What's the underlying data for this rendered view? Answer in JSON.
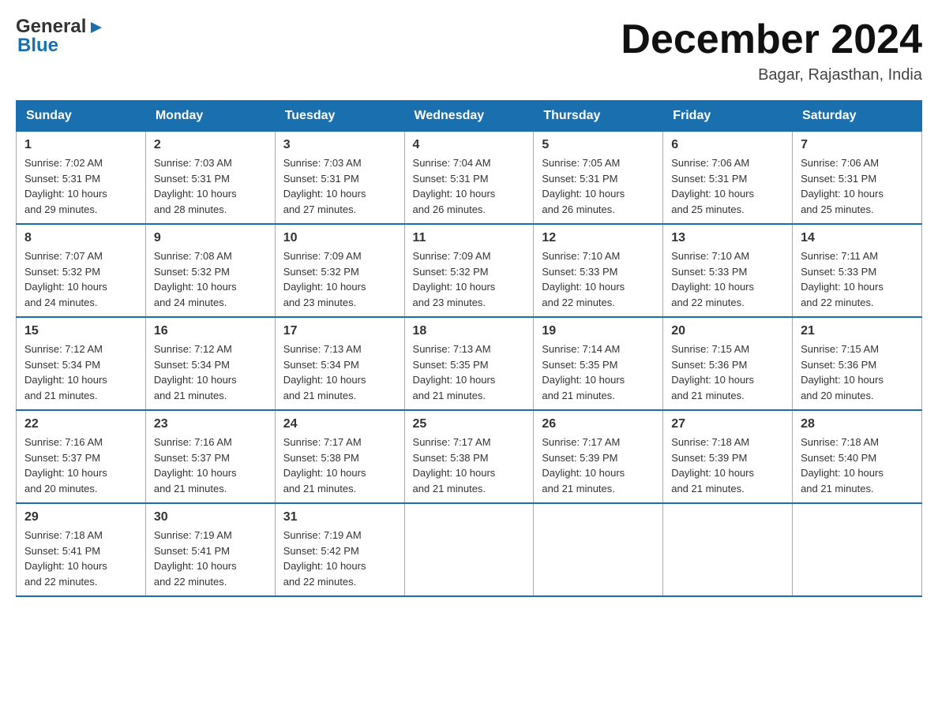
{
  "header": {
    "logo_general": "General",
    "logo_blue": "Blue",
    "month_title": "December 2024",
    "location": "Bagar, Rajasthan, India"
  },
  "days_of_week": [
    "Sunday",
    "Monday",
    "Tuesday",
    "Wednesday",
    "Thursday",
    "Friday",
    "Saturday"
  ],
  "weeks": [
    [
      {
        "day": "1",
        "sunrise": "7:02 AM",
        "sunset": "5:31 PM",
        "daylight": "10 hours and 29 minutes."
      },
      {
        "day": "2",
        "sunrise": "7:03 AM",
        "sunset": "5:31 PM",
        "daylight": "10 hours and 28 minutes."
      },
      {
        "day": "3",
        "sunrise": "7:03 AM",
        "sunset": "5:31 PM",
        "daylight": "10 hours and 27 minutes."
      },
      {
        "day": "4",
        "sunrise": "7:04 AM",
        "sunset": "5:31 PM",
        "daylight": "10 hours and 26 minutes."
      },
      {
        "day": "5",
        "sunrise": "7:05 AM",
        "sunset": "5:31 PM",
        "daylight": "10 hours and 26 minutes."
      },
      {
        "day": "6",
        "sunrise": "7:06 AM",
        "sunset": "5:31 PM",
        "daylight": "10 hours and 25 minutes."
      },
      {
        "day": "7",
        "sunrise": "7:06 AM",
        "sunset": "5:31 PM",
        "daylight": "10 hours and 25 minutes."
      }
    ],
    [
      {
        "day": "8",
        "sunrise": "7:07 AM",
        "sunset": "5:32 PM",
        "daylight": "10 hours and 24 minutes."
      },
      {
        "day": "9",
        "sunrise": "7:08 AM",
        "sunset": "5:32 PM",
        "daylight": "10 hours and 24 minutes."
      },
      {
        "day": "10",
        "sunrise": "7:09 AM",
        "sunset": "5:32 PM",
        "daylight": "10 hours and 23 minutes."
      },
      {
        "day": "11",
        "sunrise": "7:09 AM",
        "sunset": "5:32 PM",
        "daylight": "10 hours and 23 minutes."
      },
      {
        "day": "12",
        "sunrise": "7:10 AM",
        "sunset": "5:33 PM",
        "daylight": "10 hours and 22 minutes."
      },
      {
        "day": "13",
        "sunrise": "7:10 AM",
        "sunset": "5:33 PM",
        "daylight": "10 hours and 22 minutes."
      },
      {
        "day": "14",
        "sunrise": "7:11 AM",
        "sunset": "5:33 PM",
        "daylight": "10 hours and 22 minutes."
      }
    ],
    [
      {
        "day": "15",
        "sunrise": "7:12 AM",
        "sunset": "5:34 PM",
        "daylight": "10 hours and 21 minutes."
      },
      {
        "day": "16",
        "sunrise": "7:12 AM",
        "sunset": "5:34 PM",
        "daylight": "10 hours and 21 minutes."
      },
      {
        "day": "17",
        "sunrise": "7:13 AM",
        "sunset": "5:34 PM",
        "daylight": "10 hours and 21 minutes."
      },
      {
        "day": "18",
        "sunrise": "7:13 AM",
        "sunset": "5:35 PM",
        "daylight": "10 hours and 21 minutes."
      },
      {
        "day": "19",
        "sunrise": "7:14 AM",
        "sunset": "5:35 PM",
        "daylight": "10 hours and 21 minutes."
      },
      {
        "day": "20",
        "sunrise": "7:15 AM",
        "sunset": "5:36 PM",
        "daylight": "10 hours and 21 minutes."
      },
      {
        "day": "21",
        "sunrise": "7:15 AM",
        "sunset": "5:36 PM",
        "daylight": "10 hours and 20 minutes."
      }
    ],
    [
      {
        "day": "22",
        "sunrise": "7:16 AM",
        "sunset": "5:37 PM",
        "daylight": "10 hours and 20 minutes."
      },
      {
        "day": "23",
        "sunrise": "7:16 AM",
        "sunset": "5:37 PM",
        "daylight": "10 hours and 21 minutes."
      },
      {
        "day": "24",
        "sunrise": "7:17 AM",
        "sunset": "5:38 PM",
        "daylight": "10 hours and 21 minutes."
      },
      {
        "day": "25",
        "sunrise": "7:17 AM",
        "sunset": "5:38 PM",
        "daylight": "10 hours and 21 minutes."
      },
      {
        "day": "26",
        "sunrise": "7:17 AM",
        "sunset": "5:39 PM",
        "daylight": "10 hours and 21 minutes."
      },
      {
        "day": "27",
        "sunrise": "7:18 AM",
        "sunset": "5:39 PM",
        "daylight": "10 hours and 21 minutes."
      },
      {
        "day": "28",
        "sunrise": "7:18 AM",
        "sunset": "5:40 PM",
        "daylight": "10 hours and 21 minutes."
      }
    ],
    [
      {
        "day": "29",
        "sunrise": "7:18 AM",
        "sunset": "5:41 PM",
        "daylight": "10 hours and 22 minutes."
      },
      {
        "day": "30",
        "sunrise": "7:19 AM",
        "sunset": "5:41 PM",
        "daylight": "10 hours and 22 minutes."
      },
      {
        "day": "31",
        "sunrise": "7:19 AM",
        "sunset": "5:42 PM",
        "daylight": "10 hours and 22 minutes."
      },
      null,
      null,
      null,
      null
    ]
  ],
  "labels": {
    "sunrise": "Sunrise:",
    "sunset": "Sunset:",
    "daylight": "Daylight:"
  }
}
